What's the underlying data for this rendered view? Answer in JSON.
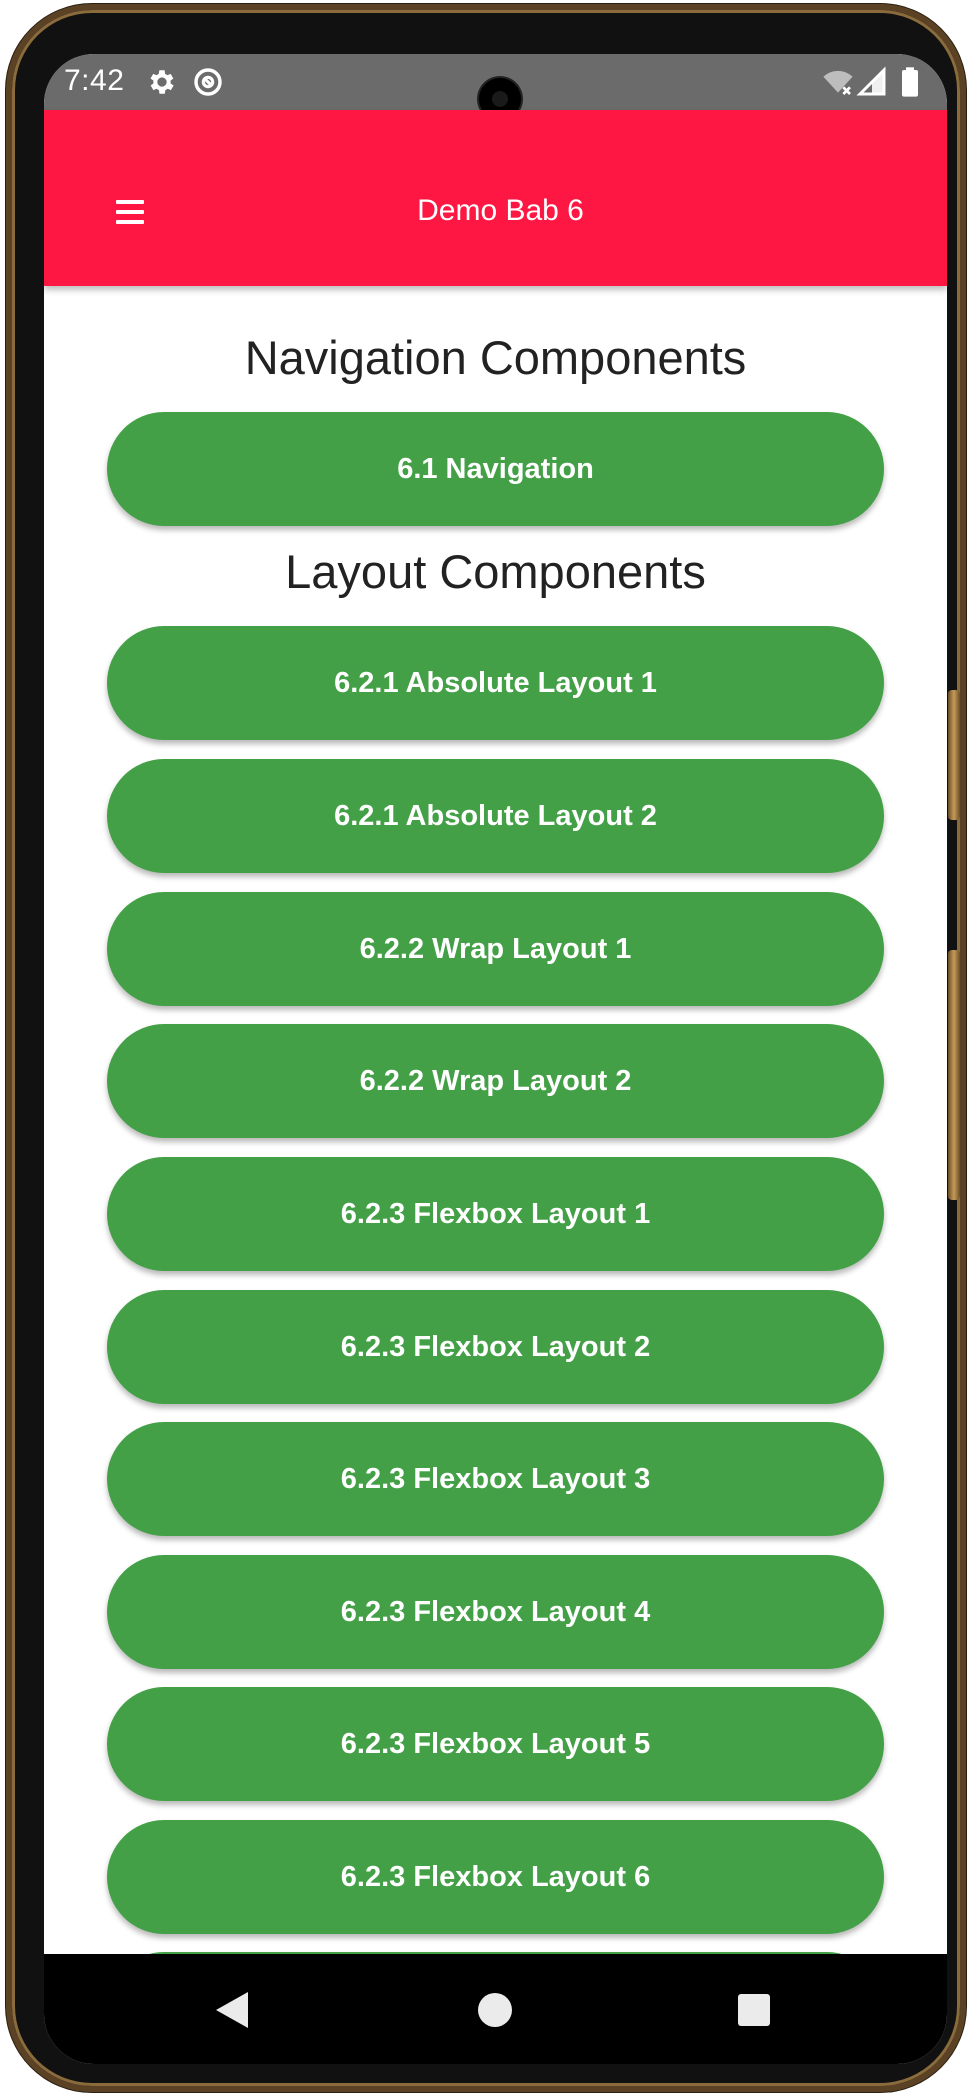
{
  "status_bar": {
    "time": "7:42",
    "icons": [
      "settings-gear-icon",
      "at-sign-icon",
      "wifi-off-icon",
      "signal-icon",
      "battery-icon"
    ]
  },
  "app_bar": {
    "title": "Demo Bab 6",
    "menu_icon": "hamburger-menu-icon",
    "color": "#ff1744"
  },
  "sections": {
    "navigation": {
      "title": "Navigation Components",
      "buttons": [
        "6.1 Navigation"
      ]
    },
    "layout": {
      "title": "Layout Components",
      "buttons": [
        "6.2.1 Absolute Layout 1",
        "6.2.1 Absolute Layout 2",
        "6.2.2 Wrap Layout 1",
        "6.2.2 Wrap Layout 2",
        "6.2.3 Flexbox Layout 1",
        "6.2.3 Flexbox Layout 2",
        "6.2.3 Flexbox Layout 3",
        "6.2.3 Flexbox Layout 4",
        "6.2.3 Flexbox Layout 5",
        "6.2.3 Flexbox Layout 6"
      ]
    }
  },
  "colors": {
    "button": "#43a047",
    "button_text": "#ffffff",
    "heading_text": "#222222"
  },
  "system_nav": {
    "icons": [
      "back-triangle-icon",
      "home-circle-icon",
      "recents-square-icon"
    ]
  }
}
